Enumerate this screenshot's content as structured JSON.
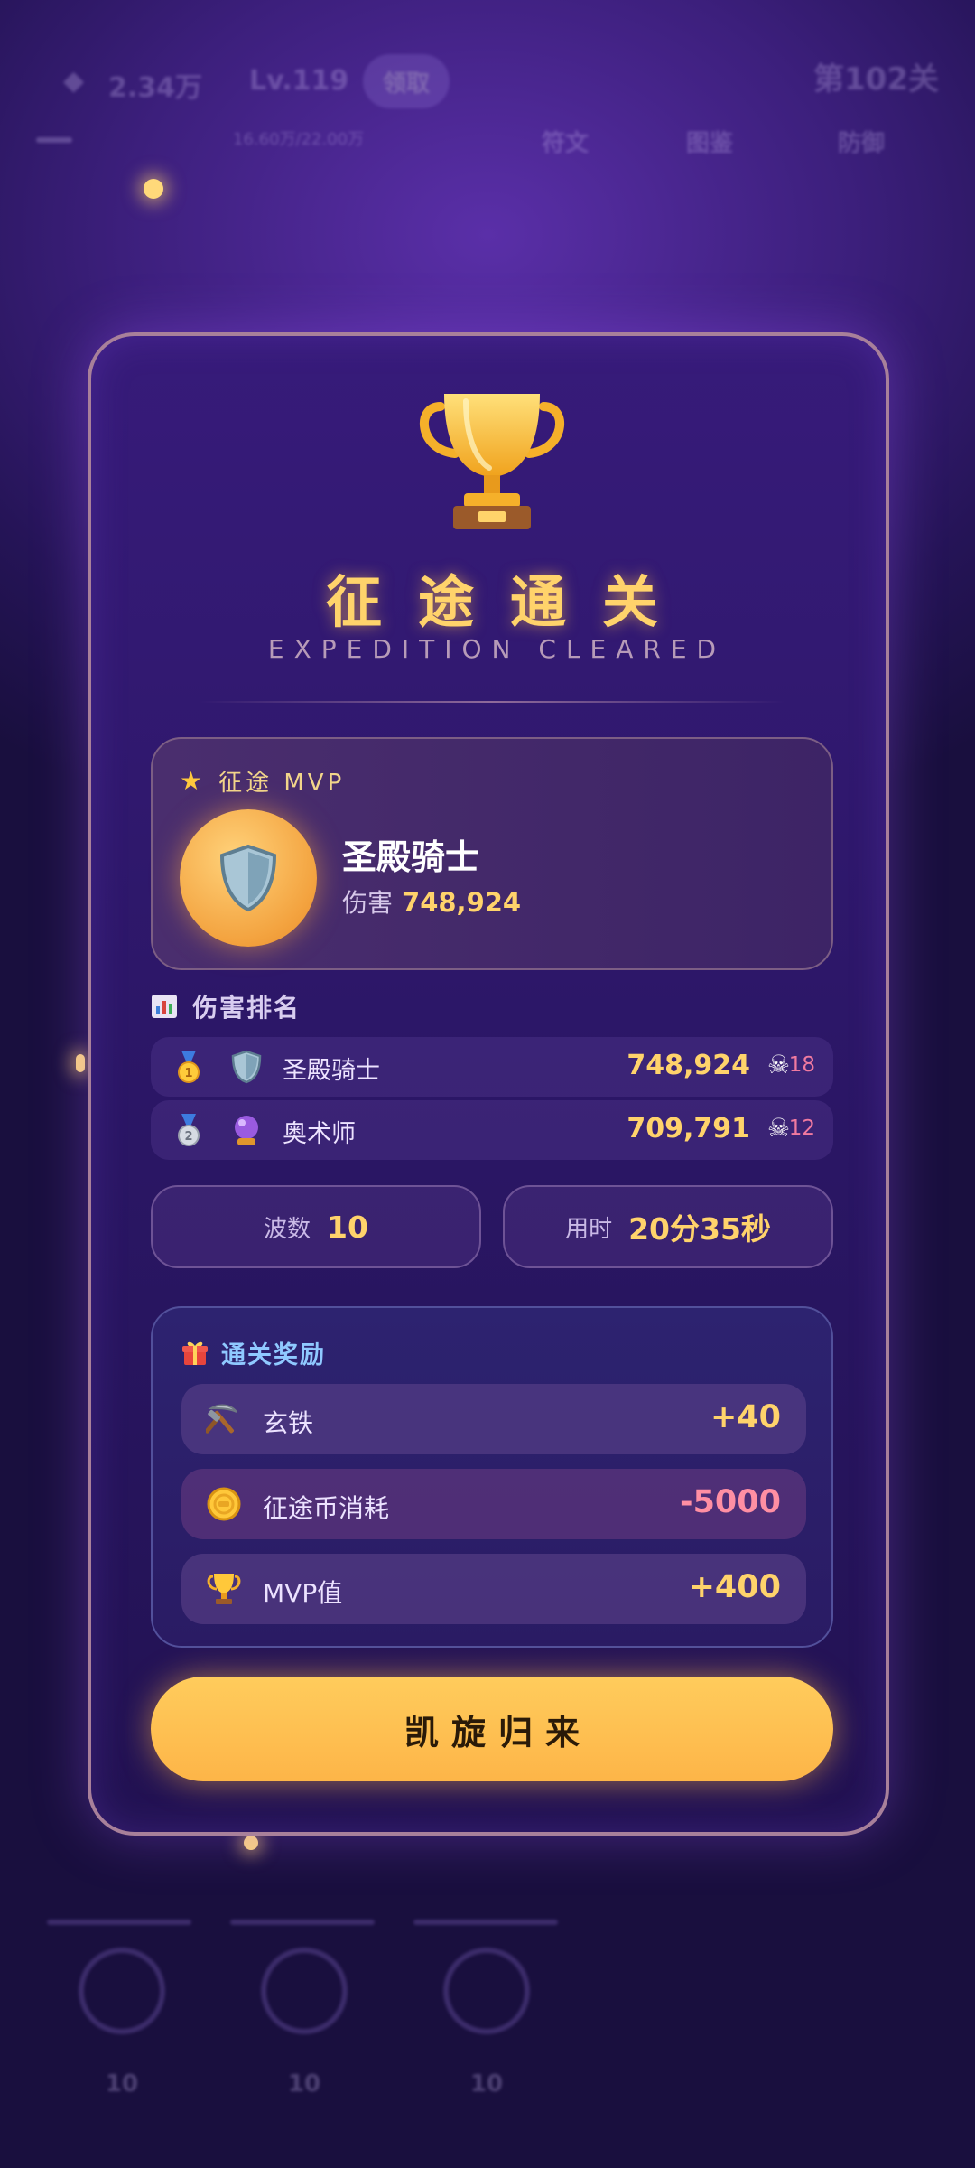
{
  "background_hud": {
    "resource_gold": "2.34万",
    "level": "Lv.119",
    "claim_label": "领取",
    "stage": "第102关",
    "progress": "16.60万/22.00万",
    "tabs": [
      "符文",
      "图鉴",
      "防御"
    ],
    "nav_costs": [
      "10",
      "10",
      "10"
    ]
  },
  "modal": {
    "title": "征途通关",
    "subtitle": "EXPEDITION CLEARED",
    "mvp": {
      "header": "征途 MVP",
      "hero_name": "圣殿骑士",
      "damage_label": "伤害",
      "damage_value": "748,924"
    },
    "ranking": {
      "header": "伤害排名",
      "rows": [
        {
          "rank": 1,
          "name": "圣殿骑士",
          "damage": "748,924",
          "kills": "18",
          "medal_icon": "gold-medal-icon",
          "hero_icon": "shield-icon"
        },
        {
          "rank": 2,
          "name": "奥术师",
          "damage": "709,791",
          "kills": "12",
          "medal_icon": "silver-medal-icon",
          "hero_icon": "crystal-ball-icon"
        }
      ]
    },
    "stats": {
      "waves_label": "波数",
      "waves_value": "10",
      "time_label": "用时",
      "time_value": "20分35秒"
    },
    "rewards": {
      "header": "通关奖励",
      "items": [
        {
          "name": "玄铁",
          "value": "+40",
          "icon": "pickaxe-icon"
        },
        {
          "name": "征途币消耗",
          "value": "-5000",
          "icon": "coin-icon"
        },
        {
          "name": "MVP值",
          "value": "+400",
          "icon": "trophy-icon"
        }
      ]
    },
    "confirm_label": "凯旋归来"
  },
  "colors": {
    "accent_gold": "#ffd36b",
    "negative": "#ff8fa3",
    "button": "#fdb548",
    "card_border": "#a8809a"
  }
}
